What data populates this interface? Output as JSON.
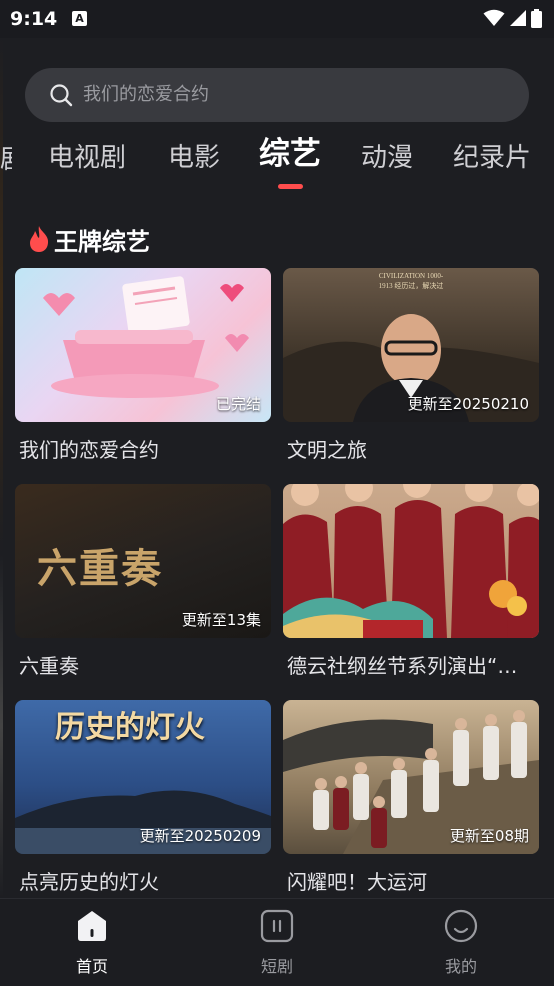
{
  "status": {
    "time": "9:14",
    "notification_icon": "A"
  },
  "search": {
    "placeholder": "我们的恋爱合约"
  },
  "tabs": [
    {
      "label": "电视剧"
    },
    {
      "label": "电影"
    },
    {
      "label": "综艺",
      "active": true
    },
    {
      "label": "动漫"
    },
    {
      "label": "纪录片"
    }
  ],
  "tab_partial": "剧",
  "section": {
    "title": "王牌综艺",
    "icon": "flame-icon",
    "icon_color": "#ff4d4d"
  },
  "cards": [
    {
      "title": "我们的恋爱合约",
      "badge": "已完结"
    },
    {
      "title": "文明之旅",
      "badge": "更新至20250210",
      "thumb_text": "CIVILIZATION 1000-1913 经历过，解决过"
    },
    {
      "title": "六重奏",
      "badge": "更新至13集",
      "thumb_text": "六重奏"
    },
    {
      "title": "德云社纲丝节系列演出“…",
      "badge": ""
    },
    {
      "title": "点亮历史的灯火",
      "badge": "更新至20250209",
      "thumb_text": "历史的灯火"
    },
    {
      "title": "闪耀吧！大运河",
      "badge": "更新至08期"
    }
  ],
  "bottom_nav": [
    {
      "label": "首页",
      "icon": "home-icon",
      "active": true
    },
    {
      "label": "短剧",
      "icon": "short-video-icon"
    },
    {
      "label": "我的",
      "icon": "profile-icon"
    }
  ],
  "colors": {
    "background": "#1d1e22",
    "accent": "#ff4d4d",
    "search_bg": "#393a3f"
  }
}
